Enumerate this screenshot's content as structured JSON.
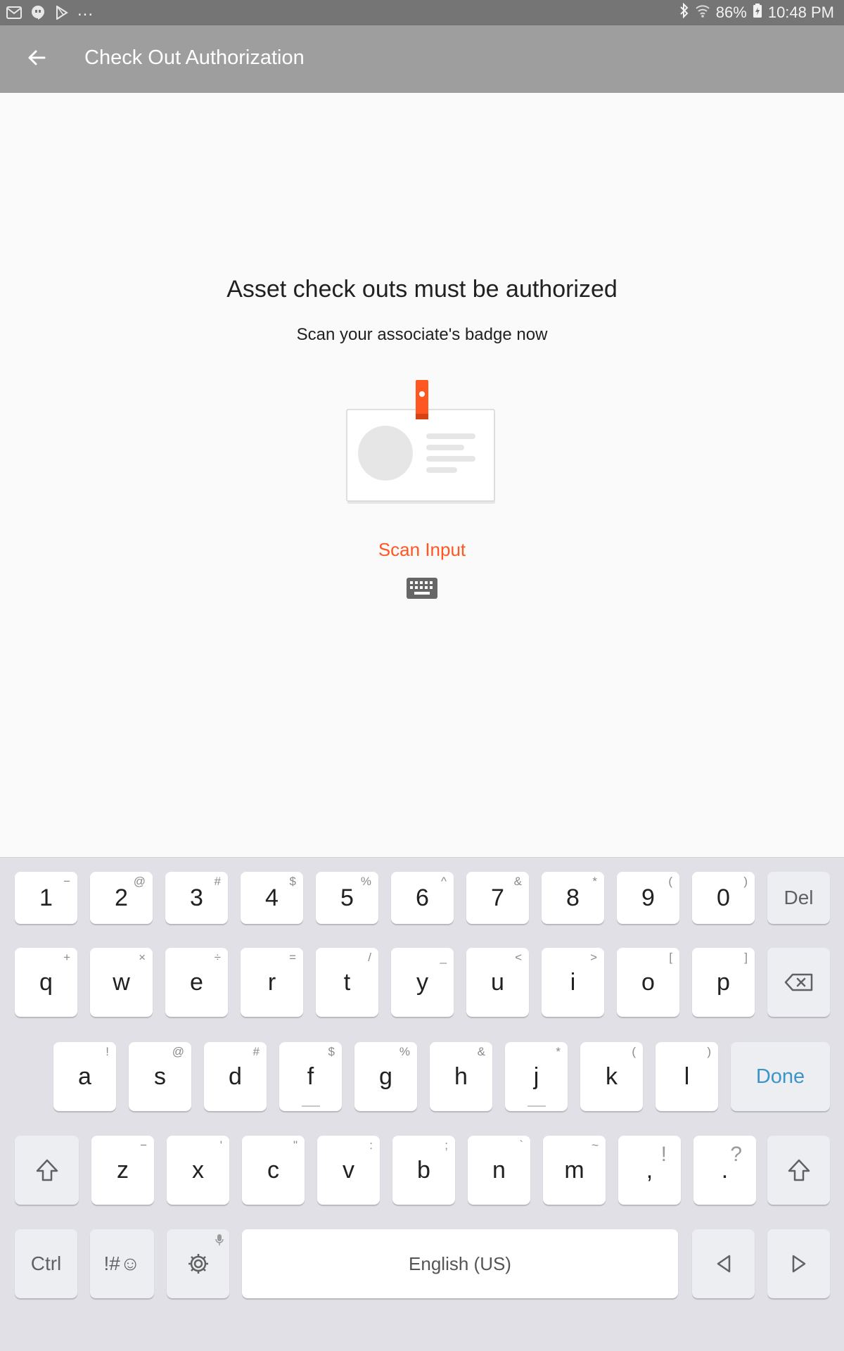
{
  "status_bar": {
    "left_icons": [
      "gmail-icon",
      "hangouts-icon",
      "play-store-icon"
    ],
    "more": "...",
    "right_icons": [
      "bluetooth-icon",
      "wifi-icon"
    ],
    "battery": "86%",
    "battery_icon": "battery-charging-icon",
    "time": "10:48 PM"
  },
  "app_bar": {
    "title": "Check Out Authorization",
    "back_icon": "arrow-back-icon"
  },
  "main": {
    "heading": "Asset check outs must be authorized",
    "subheading": "Scan your associate's badge now",
    "illustration": "id-badge-icon",
    "scan_input_label": "Scan Input",
    "keyboard_icon": "keyboard-icon"
  },
  "colors": {
    "accent": "#ff5722",
    "app_bar": "#9e9e9e",
    "status_bar": "#757575",
    "done_key": "#3d94c7"
  },
  "keyboard": {
    "row1": [
      {
        "main": "1",
        "sub": "−"
      },
      {
        "main": "2",
        "sub": "@"
      },
      {
        "main": "3",
        "sub": "#"
      },
      {
        "main": "4",
        "sub": "$"
      },
      {
        "main": "5",
        "sub": "%"
      },
      {
        "main": "6",
        "sub": "^"
      },
      {
        "main": "7",
        "sub": "&"
      },
      {
        "main": "8",
        "sub": "*"
      },
      {
        "main": "9",
        "sub": "("
      },
      {
        "main": "0",
        "sub": ")"
      }
    ],
    "del_label": "Del",
    "row2": [
      {
        "main": "q",
        "sub": "+"
      },
      {
        "main": "w",
        "sub": "×"
      },
      {
        "main": "e",
        "sub": "÷"
      },
      {
        "main": "r",
        "sub": "="
      },
      {
        "main": "t",
        "sub": "/"
      },
      {
        "main": "y",
        "sub": "_"
      },
      {
        "main": "u",
        "sub": "<"
      },
      {
        "main": "i",
        "sub": ">"
      },
      {
        "main": "o",
        "sub": "["
      },
      {
        "main": "p",
        "sub": "]"
      }
    ],
    "row3": [
      {
        "main": "a",
        "sub": "!"
      },
      {
        "main": "s",
        "sub": "@"
      },
      {
        "main": "d",
        "sub": "#"
      },
      {
        "main": "f",
        "sub": "$"
      },
      {
        "main": "g",
        "sub": "%"
      },
      {
        "main": "h",
        "sub": "&"
      },
      {
        "main": "j",
        "sub": "*"
      },
      {
        "main": "k",
        "sub": "("
      },
      {
        "main": "l",
        "sub": ")"
      }
    ],
    "done_label": "Done",
    "row4": [
      {
        "main": "z",
        "sub": "−"
      },
      {
        "main": "x",
        "sub": "'"
      },
      {
        "main": "c",
        "sub": "\""
      },
      {
        "main": "v",
        "sub": ":"
      },
      {
        "main": "b",
        "sub": ";"
      },
      {
        "main": "n",
        "sub": "`"
      },
      {
        "main": "m",
        "sub": "~"
      },
      {
        "main": ",",
        "sub": "!"
      },
      {
        "main": ".",
        "sub": "?"
      }
    ],
    "ctrl_label": "Ctrl",
    "symbols_label": "!#☺",
    "space_label": "English (US)"
  }
}
